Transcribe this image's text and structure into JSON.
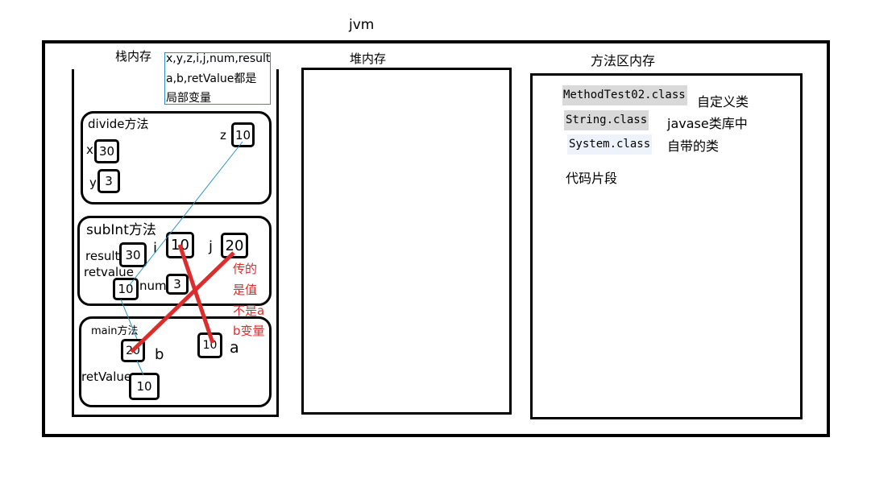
{
  "title": "jvm",
  "stack": {
    "label": "栈内存",
    "note_lines": [
      "x,y,z,i,j,num,result",
      "a,b,retValue都是",
      "局部变量"
    ],
    "divide": {
      "label": "divide方法",
      "x_label": "x",
      "x_value": "30",
      "y_label": "y",
      "y_value": "3",
      "z_label": "z",
      "z_value": "10"
    },
    "subint": {
      "label": "subInt方法",
      "result_label": "result",
      "result_value": "30",
      "i_label": "i",
      "i_value": "10",
      "j_label": "j",
      "j_value": "20",
      "retvalue_label": "retvalue",
      "retvalue_value": "10",
      "num_label": "num",
      "num_value": "3",
      "red_note_lines": [
        "传的",
        "是值",
        "不是a",
        "b变量"
      ]
    },
    "main": {
      "label": "main方法",
      "b_label": "b",
      "b_value": "20",
      "a_label": "a",
      "a_value": "10",
      "retvalue_label": "retValue",
      "retvalue_value": "10"
    }
  },
  "heap": {
    "label": "堆内存"
  },
  "method_area": {
    "label": "方法区内存",
    "classes": [
      "MethodTest02.class",
      "String.class",
      "System.class"
    ],
    "notes": [
      "自定义类",
      "javase类库中",
      "自带的类"
    ],
    "code_segment": "代码片段"
  },
  "colors": {
    "red": "#dd2c2c",
    "blue": "#2a93c4",
    "highlight": "#d9d9d9",
    "highlight_light": "#eef3fb"
  }
}
